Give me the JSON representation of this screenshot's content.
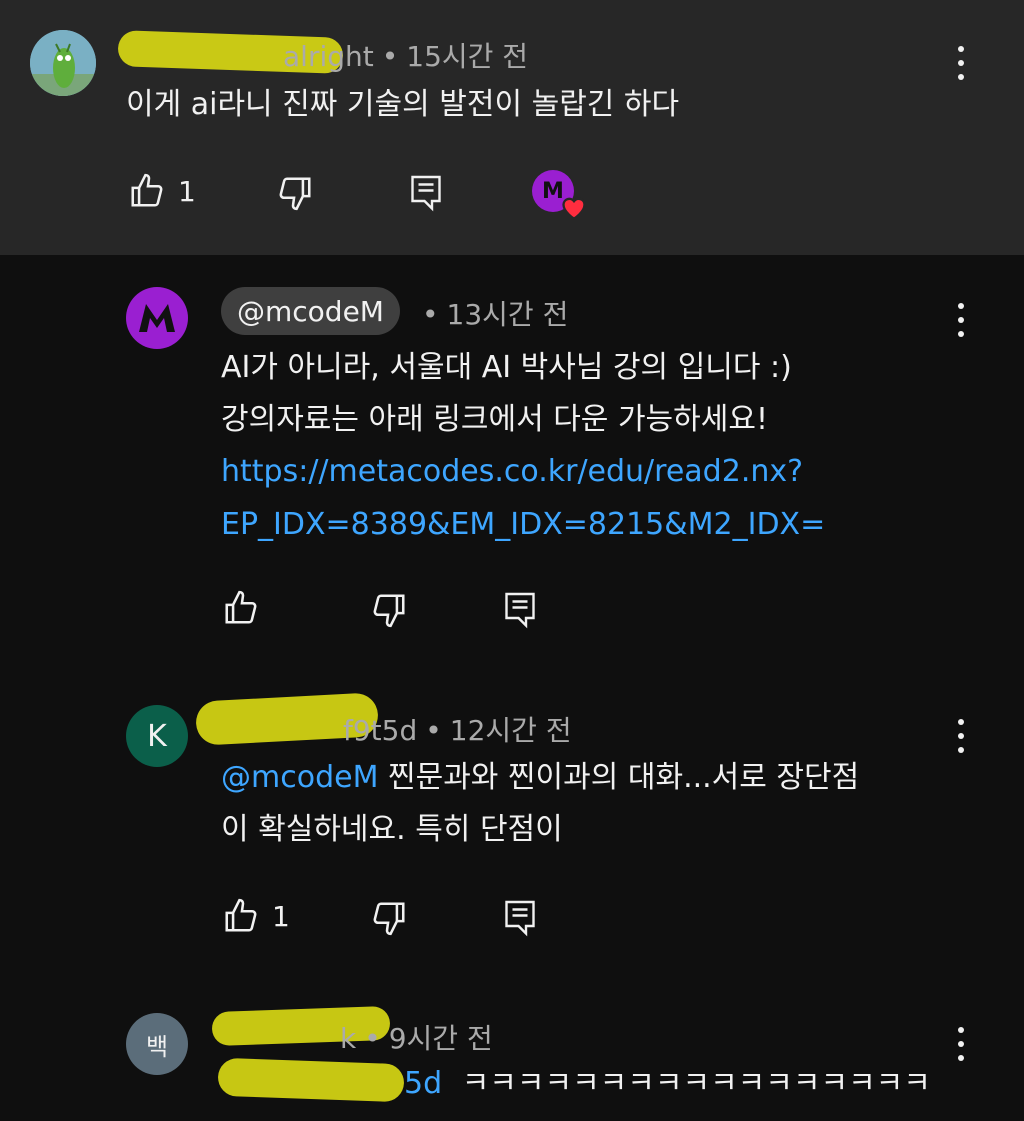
{
  "comment": {
    "author_visible": "alright",
    "time": "15시간 전",
    "text": "이게 ai라니 진짜 기술의 발전이 놀랍긴 하다",
    "like_count": "1",
    "creator_heart_avatar_letter": "M"
  },
  "replies": [
    {
      "avatar_letter": "M",
      "avatar_color": "#9a1fd1",
      "author": "@mcodeM",
      "time": "13시간 전",
      "lines": [
        "AI가 아니라, 서울대 AI 박사님 강의 입니다 :)",
        "강의자료는 아래 링크에서 다운 가능하세요!"
      ],
      "link_lines": [
        "https://metacodes.co.kr/edu/read2.nx?",
        "EP_IDX=8389&EM_IDX=8215&M2_IDX="
      ],
      "like_count": ""
    },
    {
      "avatar_letter": "K",
      "avatar_color": "#0b5f4a",
      "author_visible": "f9t5d",
      "time": "12시간 전",
      "mention": "@mcodeM",
      "line1_rest": " 찐문과와 찐이과의 대화...서로 장단점",
      "line2": "이 확실하네요. 특히 단점이",
      "like_count": "1"
    },
    {
      "avatar_letter": "백",
      "avatar_color": "#5b6d7a",
      "author_visible": "k",
      "time": "9시간 전",
      "mention_visible": "5d",
      "text": "ㅋㅋㅋㅋㅋㅋㅋㅋㅋㅋㅋㅋㅋㅋㅋㅋㅋ"
    }
  ],
  "colors": {
    "background": "#0f0f0f",
    "highlight_bg": "#272727",
    "link": "#3ea6ff",
    "meta": "#aaaaaa",
    "redaction": "#d7d713"
  },
  "icons": [
    "like-icon",
    "dislike-icon",
    "reply-icon",
    "more-options-icon",
    "heart-icon"
  ]
}
